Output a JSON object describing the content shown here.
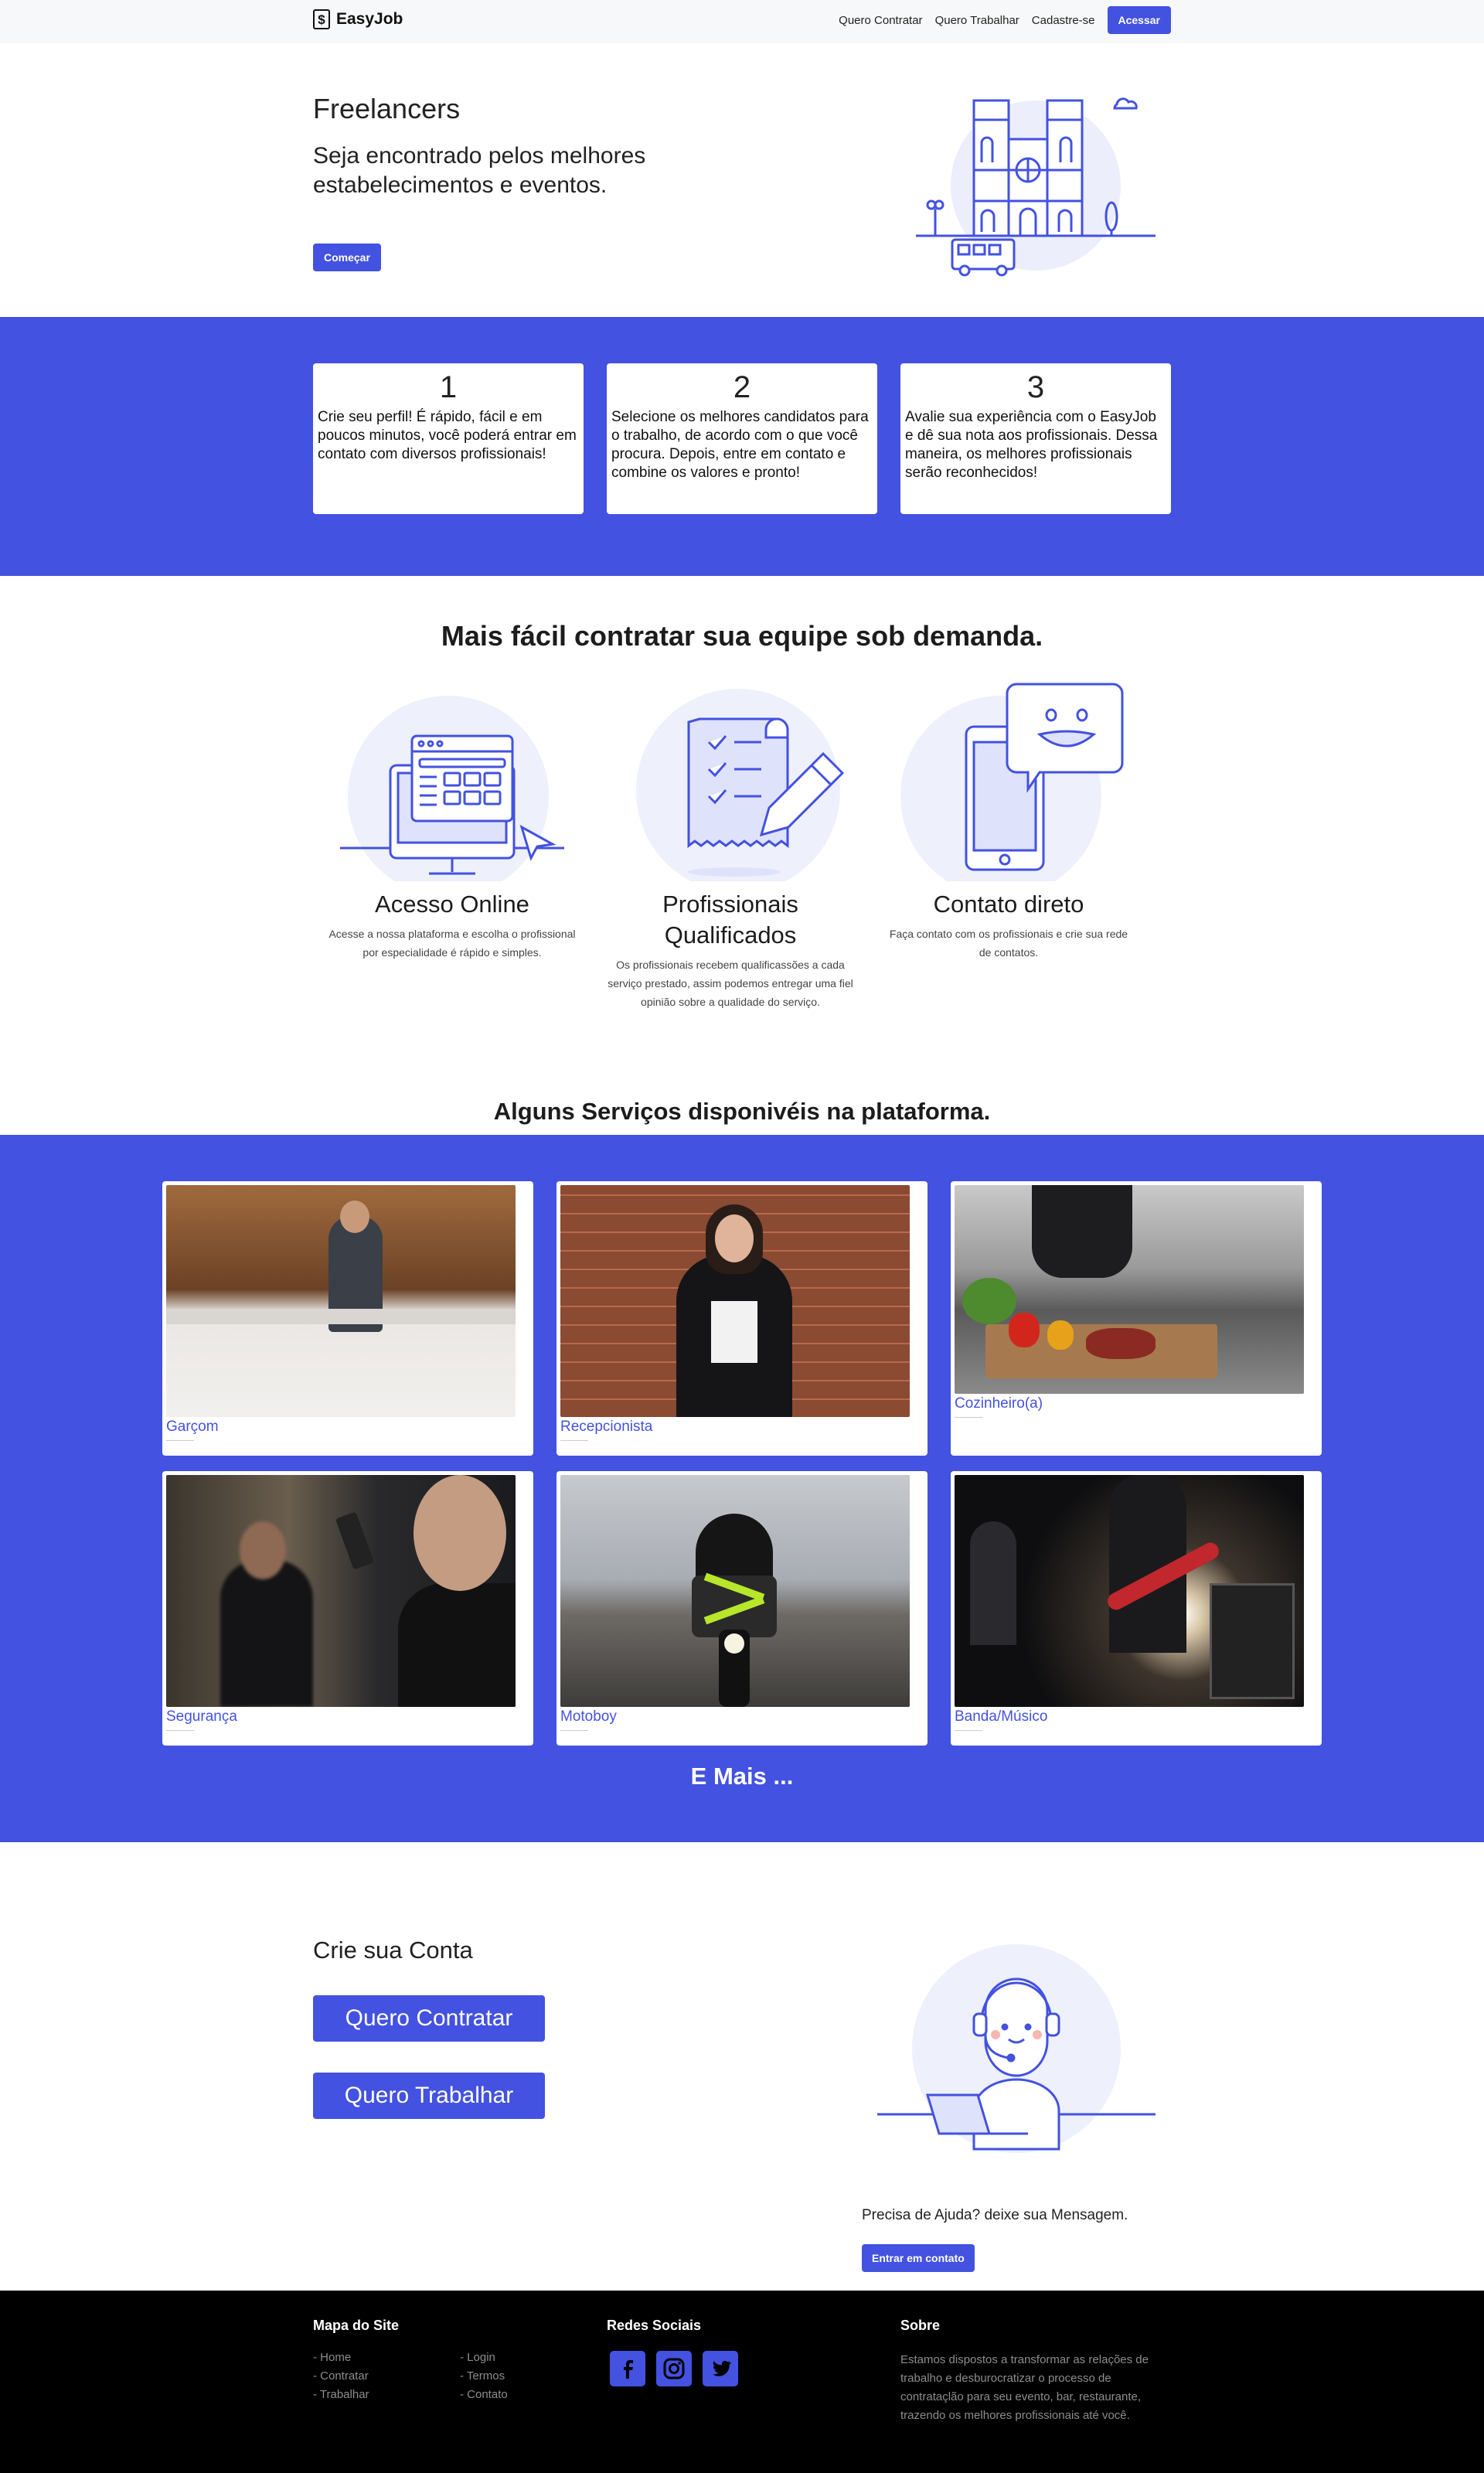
{
  "navbar": {
    "brand": "EasyJob",
    "brand_icon": "dollar-box-icon",
    "links": [
      "Quero Contratar",
      "Quero Trabalhar",
      "Cadastre-se"
    ],
    "login_label": "Acessar"
  },
  "hero": {
    "title": "Freelancers",
    "subtitle": "Seja encontrado pelos melhores estabelecimentos e eventos.",
    "start_label": "Começar",
    "illustration": "cathedral-bus-illustration"
  },
  "steps": [
    {
      "number": "1",
      "text": "Crie seu perfil! É rápido, fácil e em poucos minutos, você poderá entrar em contato com diversos profissionais!"
    },
    {
      "number": "2",
      "text": "Selecione os melhores candidatos para o trabalho, de acordo com o que você procura. Depois, entre em contato e combine os valores e pronto!"
    },
    {
      "number": "3",
      "text": "Avalie sua experiência com o EasyJob e dê sua nota aos profissionais. Dessa maneira, os melhores profissionais serão reconhecidos!"
    }
  ],
  "features": {
    "heading": "Mais fácil contratar sua equipe sob demanda.",
    "items": [
      {
        "title": "Acesso Online",
        "text": "Acesse a nossa plataforma e escolha o profissional por especialidade é rápido e simples.",
        "icon": "monitor-icon"
      },
      {
        "title": "Profissionais Qualificados",
        "text": "Os profissionais recebem qualificassões a cada serviço prestado, assim podemos entregar uma fiel opinião sobre a qualidade do serviço.",
        "icon": "checklist-icon"
      },
      {
        "title": "Contato direto",
        "text": "Faça contato com os profissionais e crie sua rede de contatos.",
        "icon": "phone-chat-icon"
      }
    ]
  },
  "services": {
    "heading": "Alguns Serviços disponivéis na plataforma.",
    "items": [
      {
        "label": "Garçom",
        "photo": "waiter-photo"
      },
      {
        "label": "Recepcionista",
        "photo": "receptionist-photo"
      },
      {
        "label": "Cozinheiro(a)",
        "photo": "cook-photo"
      },
      {
        "label": "Segurança",
        "photo": "security-photo"
      },
      {
        "label": "Motoboy",
        "photo": "motoboy-photo"
      },
      {
        "label": "Banda/Músico",
        "photo": "band-photo"
      }
    ],
    "more_label": "E Mais ..."
  },
  "signup": {
    "title": "Crie sua Conta",
    "hire_label": "Quero Contratar",
    "work_label": "Quero Trabalhar",
    "help_text": "Precisa de Ajuda? deixe sua Mensagem.",
    "contact_label": "Entrar em contato"
  },
  "footer": {
    "sitemap_title": "Mapa do Site",
    "sitemap_left": [
      "- Home",
      "- Contratar",
      "- Trabalhar"
    ],
    "sitemap_right": [
      "- Login",
      "- Termos",
      "- Contato"
    ],
    "social_title": "Redes Sociais",
    "social_icons": [
      "facebook-icon",
      "instagram-icon",
      "twitter-icon"
    ],
    "about_title": "Sobre",
    "about_text": "Estamos dispostos a transformar as relações de trabalho e desburocratizar o processo de contrataçlão para seu evento, bar, restaurante, trazendo os melhores profissionais até você."
  },
  "colors": {
    "accent": "#4352e0",
    "footer_bg": "#000000",
    "navbar_bg": "#f7f8f9"
  }
}
